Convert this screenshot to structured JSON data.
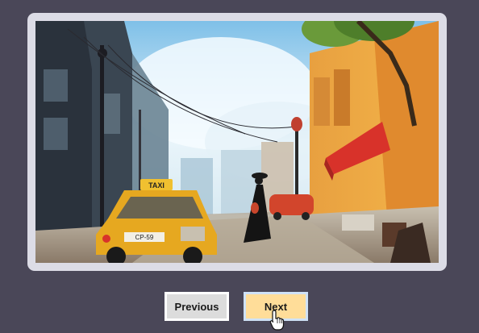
{
  "slider": {
    "image": {
      "description_icon": "painting-image",
      "taxi_label": "TAXI",
      "plate_text": "CP-59"
    },
    "controls": {
      "previous_label": "Previous",
      "next_label": "Next"
    },
    "colors": {
      "background": "#4a4758",
      "frame": "#dcdce6",
      "previous_bg": "#dcdcdc",
      "next_bg": "#ffdd99"
    }
  },
  "cursor": {
    "icon": "hand-pointer-icon"
  }
}
